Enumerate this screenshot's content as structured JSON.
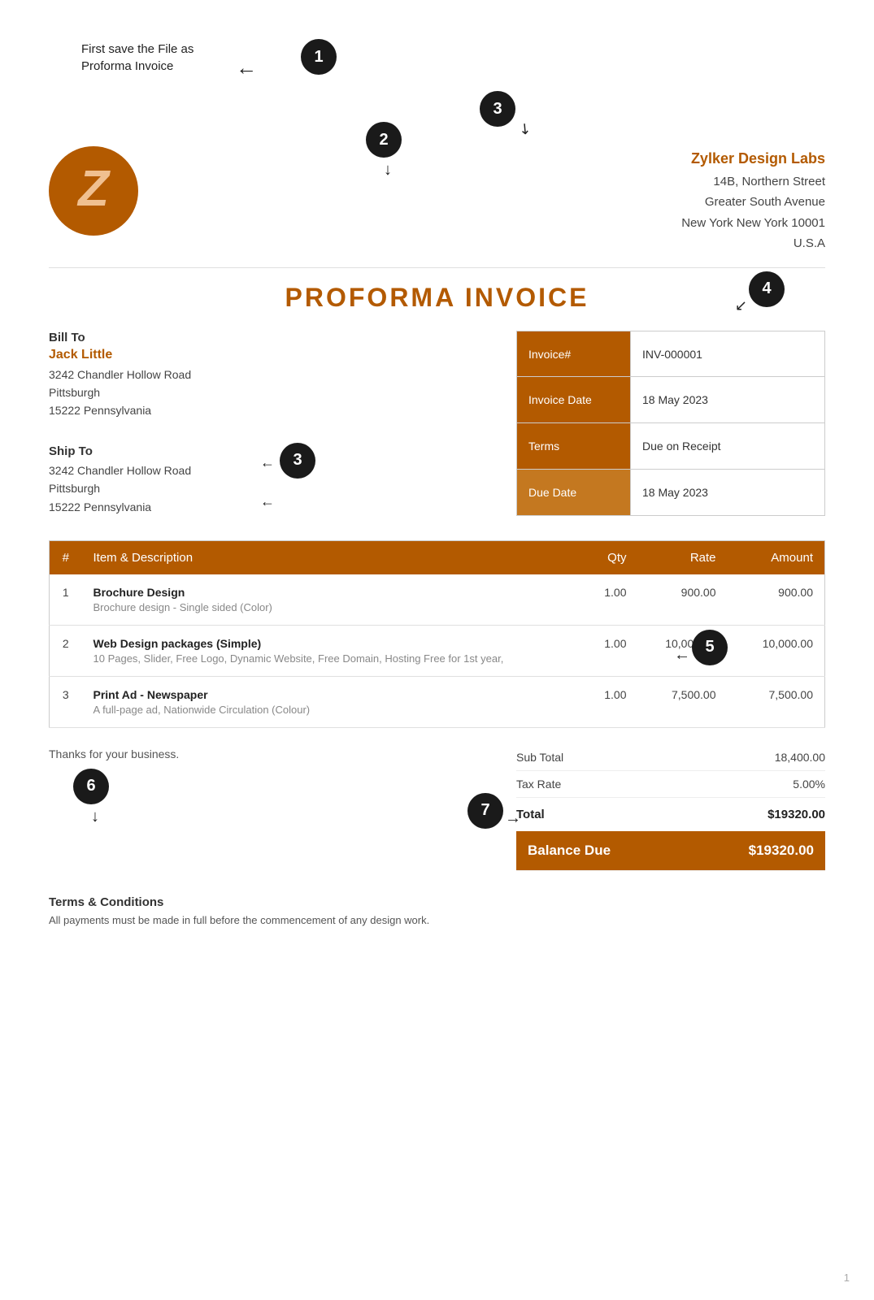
{
  "annotation": {
    "step1_text": "First save the File as\nProforma Invoice",
    "badge1": "1",
    "badge2": "2",
    "badge3": "3",
    "badge4": "4",
    "badge5": "5",
    "badge6": "6",
    "badge7": "7"
  },
  "company": {
    "name": "Zylker Design Labs",
    "address_line1": "14B, Northern Street",
    "address_line2": "Greater South Avenue",
    "address_line3": "New York New York 10001",
    "address_line4": "U.S.A",
    "logo_letter": "Z"
  },
  "invoice": {
    "title": "PROFORMA INVOICE",
    "number_label": "Invoice#",
    "number_value": "INV-000001",
    "date_label": "Invoice Date",
    "date_value": "18 May 2023",
    "terms_label": "Terms",
    "terms_value": "Due on Receipt",
    "due_date_label": "Due Date",
    "due_date_value": "18 May 2023"
  },
  "bill_to": {
    "label": "Bill To",
    "name": "Jack Little",
    "address_line1": "3242 Chandler Hollow Road",
    "address_line2": "Pittsburgh",
    "address_line3": "15222 Pennsylvania"
  },
  "ship_to": {
    "label": "Ship To",
    "address_line1": "3242 Chandler Hollow Road",
    "address_line2": "Pittsburgh",
    "address_line3": "15222 Pennsylvania"
  },
  "table_headers": {
    "num": "#",
    "item": "Item & Description",
    "qty": "Qty",
    "rate": "Rate",
    "amount": "Amount"
  },
  "line_items": [
    {
      "num": "1",
      "name": "Brochure Design",
      "description": "Brochure design - Single sided (Color)",
      "qty": "1.00",
      "rate": "900.00",
      "amount": "900.00"
    },
    {
      "num": "2",
      "name": "Web Design packages (Simple)",
      "description": "10 Pages, Slider, Free Logo, Dynamic Website, Free Domain, Hosting Free for 1st year,",
      "qty": "1.00",
      "rate": "10,000.00",
      "amount": "10,000.00"
    },
    {
      "num": "3",
      "name": "Print Ad - Newspaper",
      "description": "A full-page ad, Nationwide Circulation (Colour)",
      "qty": "1.00",
      "rate": "7,500.00",
      "amount": "7,500.00"
    }
  ],
  "totals": {
    "thanks_text": "Thanks for your business.",
    "sub_total_label": "Sub Total",
    "sub_total_value": "18,400.00",
    "tax_rate_label": "Tax Rate",
    "tax_rate_value": "5.00%",
    "total_label": "Total",
    "total_value": "$19320.00",
    "balance_due_label": "Balance Due",
    "balance_due_value": "$19320.00"
  },
  "terms_conditions": {
    "title": "Terms & Conditions",
    "text": "All payments must be made in full before the commencement of any design work."
  },
  "page_number": "1"
}
